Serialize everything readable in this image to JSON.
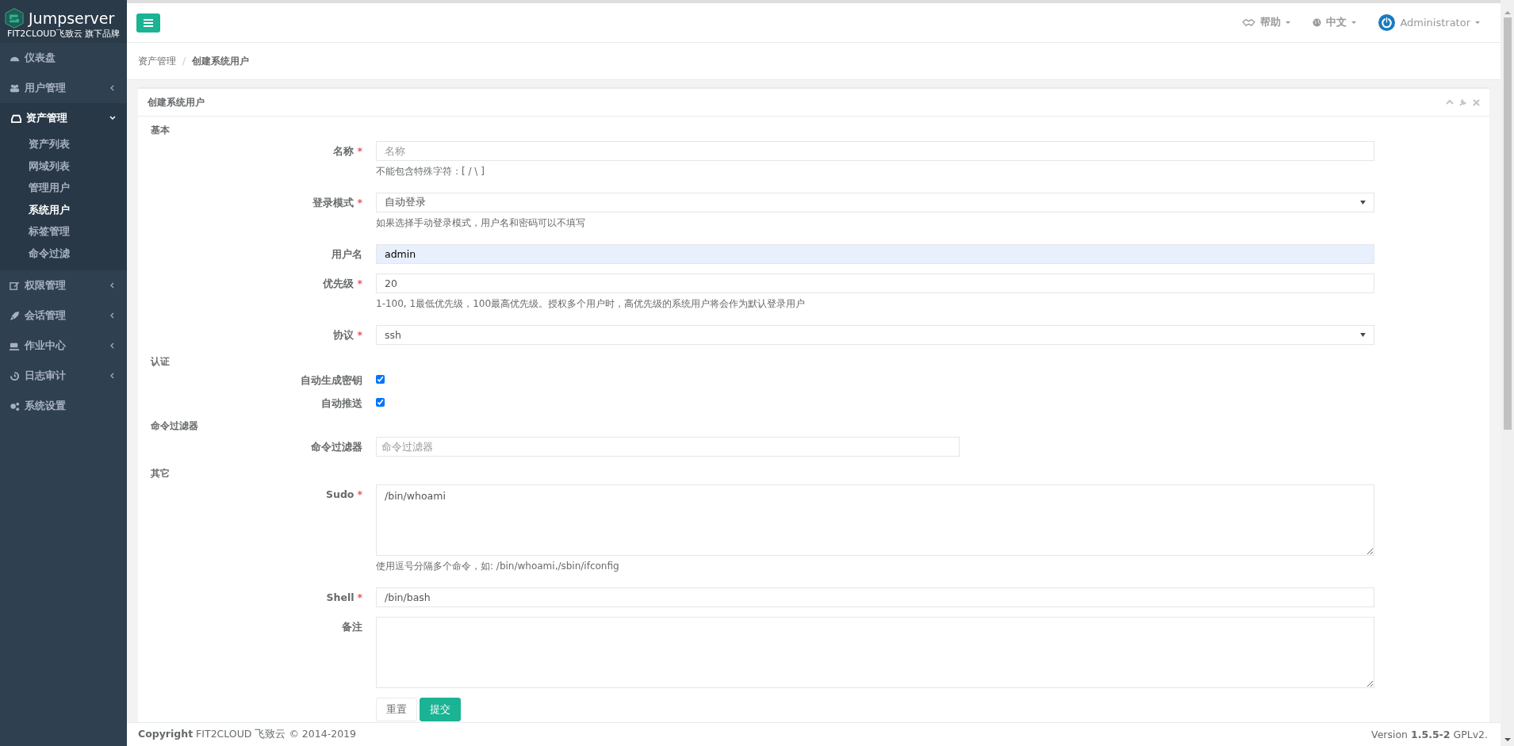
{
  "brand": {
    "name": "Jumpserver",
    "tagline": "FIT2CLOUD飞致云 旗下品牌"
  },
  "sidebar": {
    "items": [
      {
        "label": "仪表盘",
        "kind": "link"
      },
      {
        "label": "用户管理",
        "kind": "group",
        "expanded": false
      },
      {
        "label": "资产管理",
        "kind": "group",
        "expanded": true,
        "children": [
          {
            "label": "资产列表",
            "selected": false
          },
          {
            "label": "网域列表",
            "selected": false
          },
          {
            "label": "管理用户",
            "selected": false
          },
          {
            "label": "系统用户",
            "selected": true
          },
          {
            "label": "标签管理",
            "selected": false
          },
          {
            "label": "命令过滤",
            "selected": false
          }
        ]
      },
      {
        "label": "权限管理",
        "kind": "group",
        "expanded": false
      },
      {
        "label": "会话管理",
        "kind": "group",
        "expanded": false
      },
      {
        "label": "作业中心",
        "kind": "group",
        "expanded": false
      },
      {
        "label": "日志审计",
        "kind": "group",
        "expanded": false
      },
      {
        "label": "系统设置",
        "kind": "link"
      }
    ]
  },
  "topbar": {
    "help": "帮助",
    "language": "中文",
    "user": "Administrator"
  },
  "breadcrumb": {
    "items": [
      "资产管理",
      "创建系统用户"
    ],
    "separator": "/"
  },
  "panel": {
    "title": "创建系统用户"
  },
  "sections": [
    {
      "title": "基本",
      "fields": [
        {
          "label": "名称",
          "required_mark": "*",
          "kind": "text",
          "placeholder": "名称",
          "help": "不能包含特殊字符：[ / \\ ]"
        },
        {
          "label": "登录模式",
          "required_mark": "*",
          "kind": "select",
          "value": "自动登录",
          "help": "如果选择手动登录模式，用户名和密码可以不填写"
        },
        {
          "label": "用户名",
          "kind": "text",
          "value": "admin",
          "autofilled": true
        },
        {
          "label": "优先级",
          "required_mark": "*",
          "kind": "text",
          "value": "20",
          "help": "1-100, 1最低优先级，100最高优先级。授权多个用户时，高优先级的系统用户将会作为默认登录用户"
        },
        {
          "label": "协议",
          "required_mark": "*",
          "kind": "select",
          "value": "ssh"
        }
      ]
    },
    {
      "title": "认证",
      "fields": [
        {
          "label": "自动生成密钥",
          "kind": "checkbox",
          "checked": true
        },
        {
          "label": "自动推送",
          "kind": "checkbox",
          "checked": true
        }
      ]
    },
    {
      "title": "命令过滤器",
      "fields": [
        {
          "label": "命令过滤器",
          "kind": "tags",
          "placeholder": "命令过滤器"
        }
      ]
    },
    {
      "title": "其它",
      "fields": [
        {
          "label": "Sudo",
          "required_mark": "*",
          "kind": "textarea",
          "value": "/bin/whoami",
          "help": "使用逗号分隔多个命令，如: /bin/whoami,/sbin/ifconfig"
        },
        {
          "label": "Shell",
          "required_mark": "*",
          "kind": "text",
          "value": "/bin/bash"
        },
        {
          "label": "备注",
          "kind": "textarea"
        }
      ]
    }
  ],
  "buttons": [
    {
      "label": "重置",
      "kind": "default"
    },
    {
      "label": "提交",
      "kind": "primary"
    }
  ],
  "footer": {
    "copyright": "**Copyright** FIT2CLOUD 飞致云 © 2014-2019",
    "version": "Version **1.5.5-2** GPLv2."
  }
}
